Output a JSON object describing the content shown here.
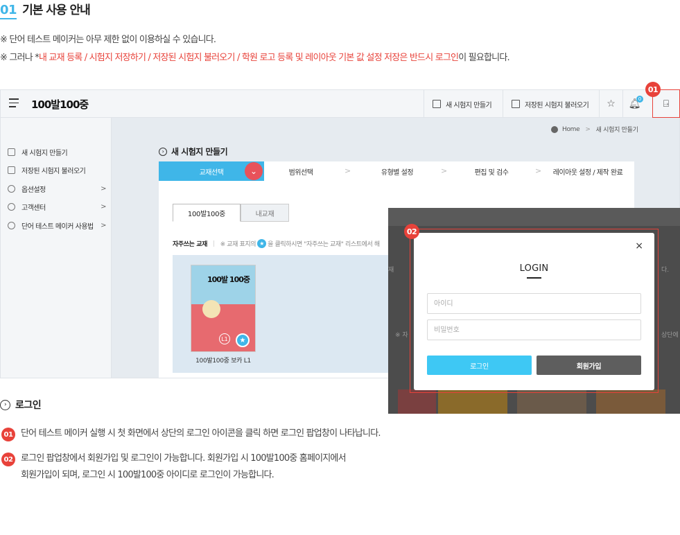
{
  "header": {
    "num": "01",
    "title": "기본 사용 안내"
  },
  "notes": {
    "line1": "※ 단어 테스트 메이커는 아무 제한 없이 이용하실 수 있습니다.",
    "line2_prefix": "※ 그러나 *",
    "line2_red": "내 교재 등록 / 시험지 저장하기 / 저장된 시험지 불러오기 /  학원 로고 등록 및 레이아웃 기본 값 설정 저장은  반드시 로그인",
    "line2_suffix": "이 필요합니다."
  },
  "app": {
    "logo": "100발100중",
    "topbar": {
      "new_test": "새 시험지 만들기",
      "load_saved": "저장된 시험지 불러오기",
      "notif_count": "0"
    },
    "sidebar": {
      "items": [
        {
          "label": "새 시험지 만들기",
          "icon": "new-doc-icon",
          "arrow": ""
        },
        {
          "label": "저장된 시험지 불러오기",
          "icon": "load-icon",
          "arrow": ""
        },
        {
          "label": "옵션설정",
          "icon": "gear-icon",
          "arrow": ">"
        },
        {
          "label": "고객센터",
          "icon": "chat-icon",
          "arrow": ">"
        },
        {
          "label": "단어 테스트 메이커 사용법",
          "icon": "help-icon",
          "arrow": ">"
        }
      ]
    },
    "breadcrumb": {
      "home": "Home",
      "sep": ">",
      "current": "새 시험지 만들기"
    },
    "page_title": "새 시험지 만들기",
    "steps": [
      "교재선택",
      "범위선택",
      "유형별 설정",
      "편집 및 검수",
      "레이아웃 설정 / 제작 완료"
    ],
    "step_sep": ">",
    "tabs": [
      "100발100중",
      "내교재"
    ],
    "favorites": {
      "label": "자주쓰는 교재",
      "hint_a": "※ 교재 표지의",
      "hint_b": "을 클릭하시면 \"자주쓰는 교재\" 리스트에서 해"
    },
    "book": {
      "title": "100발 100중",
      "level": "L1",
      "caption": "100발100중 보카 L1"
    }
  },
  "popup": {
    "close": "×",
    "title": "LOGIN",
    "id_placeholder": "아이디",
    "pw_placeholder": "비밀번호",
    "login_button": "로그인",
    "join_button": "회원가입",
    "dim_texts": [
      "상단에",
      "다.",
      "※ 자",
      "재"
    ]
  },
  "callouts": {
    "c1": "01",
    "c2": "02"
  },
  "section": {
    "title": "로그인",
    "items": [
      {
        "num": "01",
        "lines": [
          "단어 테스트 메이커 실행 시 첫 화면에서 상단의 로그인 아이콘을  클릭 하면 로그인 팝업창이 나타납니다."
        ]
      },
      {
        "num": "02",
        "lines": [
          "로그인 팝업창에서 회원가입 및 로그인이 가능합니다.  회원가입 시 100발100중 홈페이지에서",
          "회원가입이 되며, 로그인 시  100발100중 아이디로 로그인이 가능합니다."
        ]
      }
    ]
  },
  "colors": {
    "accent_blue": "#3fb6e8",
    "callout_red": "#e8423a",
    "login_btn": "#3ec8f4",
    "join_btn": "#5e5e5e"
  }
}
